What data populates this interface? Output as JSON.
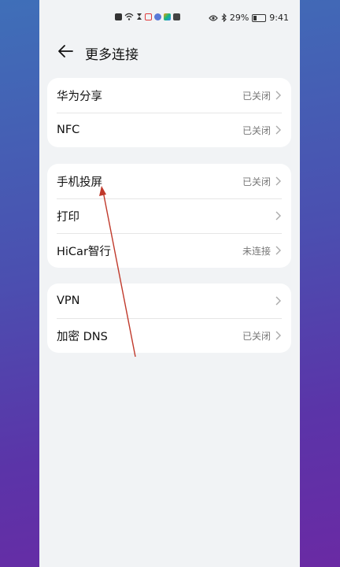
{
  "status_bar": {
    "battery": "29%",
    "time": "9:41"
  },
  "header": {
    "title": "更多连接"
  },
  "groups": [
    {
      "items": [
        {
          "label": "华为分享",
          "status": "已关闭"
        },
        {
          "label": "NFC",
          "status": "已关闭"
        }
      ]
    },
    {
      "items": [
        {
          "label": "手机投屏",
          "status": "已关闭"
        },
        {
          "label": "打印",
          "status": ""
        },
        {
          "label": "HiCar智行",
          "status": "未连接"
        }
      ]
    },
    {
      "items": [
        {
          "label": "VPN",
          "status": ""
        },
        {
          "label": "加密 DNS",
          "status": "已关闭"
        }
      ]
    }
  ],
  "colors": {
    "annotation_arrow": "#c0392b",
    "card_bg": "#ffffff",
    "screen_bg": "#f1f3f5"
  }
}
